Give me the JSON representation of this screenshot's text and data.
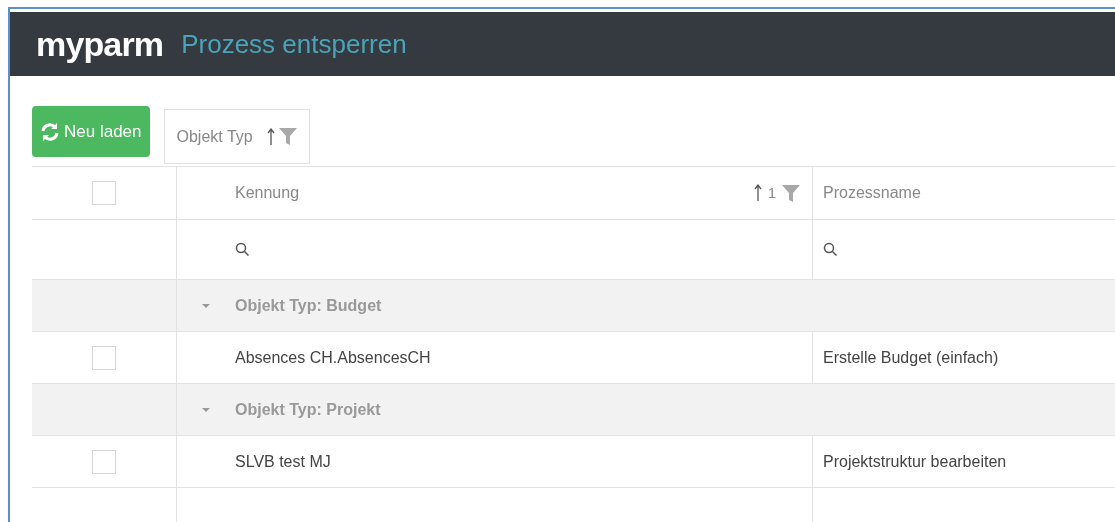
{
  "header": {
    "logo": "myparm",
    "title": "Prozess entsperren"
  },
  "toolbar": {
    "reload_button": "Neu laden",
    "group_chip": {
      "label": "Objekt Typ"
    }
  },
  "table": {
    "select_all": {
      "checked": false
    },
    "columns": [
      {
        "label": "Kennung",
        "sort_order": "1"
      },
      {
        "label": "Prozessname"
      }
    ],
    "groups": [
      {
        "label": "Objekt Typ: Budget",
        "expanded": true,
        "rows": [
          {
            "checked": false,
            "cells": [
              "Absences CH.AbsencesCH",
              "Erstelle Budget (einfach)"
            ]
          }
        ]
      },
      {
        "label": "Objekt Typ: Projekt",
        "expanded": true,
        "rows": [
          {
            "checked": false,
            "cells": [
              "SLVB test MJ",
              "Projektstruktur bearbeiten"
            ]
          }
        ]
      }
    ]
  }
}
